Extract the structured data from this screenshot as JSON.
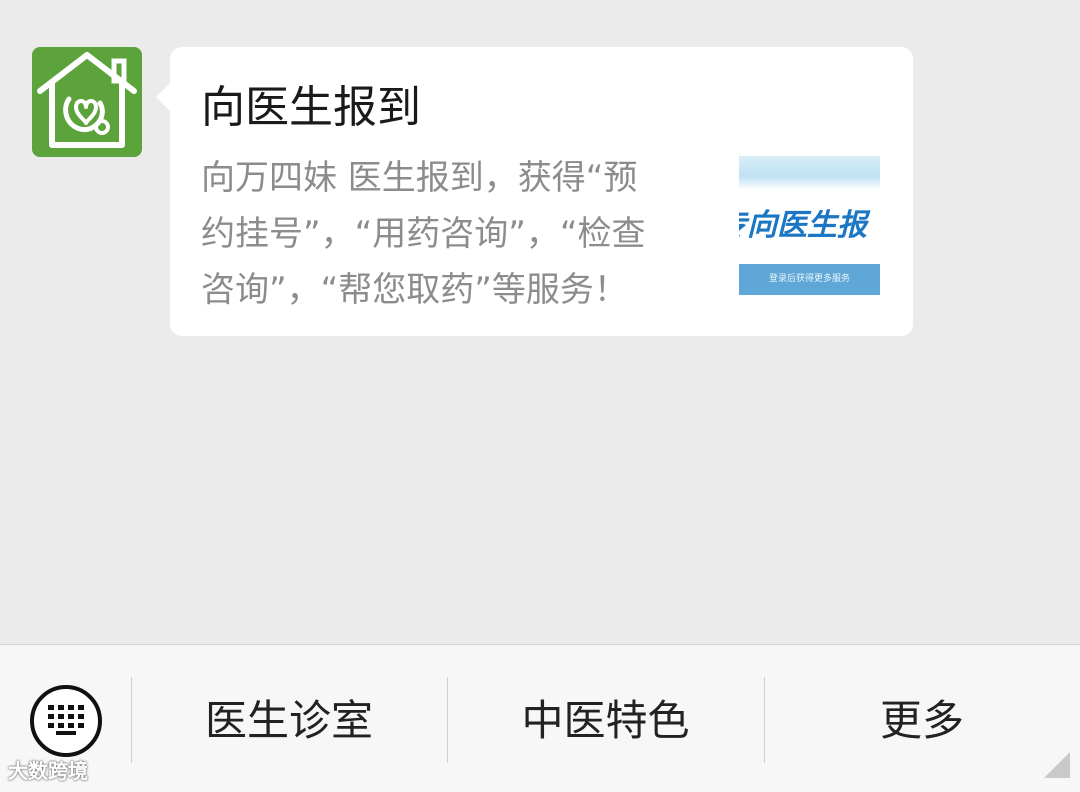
{
  "message": {
    "avatar_icon": "house-stethoscope-icon",
    "avatar_color": "#5ba33a",
    "card": {
      "title": "向医生报到",
      "description_lines": [
        "向万四妹 医生报到，获得“预",
        "约挂号”，“用药咨询”，“检查",
        "咨询”，“帮您取药”等服务！"
      ],
      "thumbnail": {
        "title": "专向医生报",
        "banner": "登录后获得更多服务"
      }
    }
  },
  "menu_bar": {
    "keyboard_icon": "keyboard-icon",
    "items": [
      {
        "label": "医生诊室"
      },
      {
        "label": "中医特色"
      },
      {
        "label": "更多"
      }
    ]
  },
  "watermark": {
    "text": "大数跨境"
  }
}
